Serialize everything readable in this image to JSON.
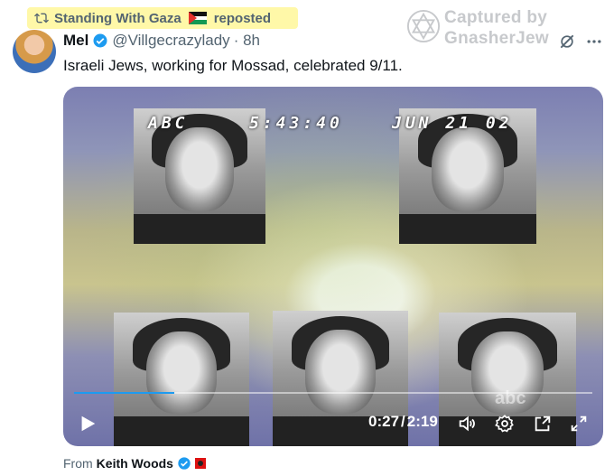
{
  "repost": {
    "reposter": "Standing With Gaza",
    "action": "reposted"
  },
  "watermark": {
    "line1": "Captured by",
    "line2": "GnasherJew"
  },
  "tweet": {
    "author_name": "Mel",
    "handle": "@Villgecrazylady",
    "time": "· 8h",
    "text": "Israeli Jews, working for Mossad, celebrated 9/11."
  },
  "video": {
    "overlay": {
      "network": "ABC",
      "clock": "5:43:40",
      "date": "JUN 21 02"
    },
    "bug": "abc",
    "current_time": "0:27",
    "separator": "/",
    "duration": "2:19",
    "progress_fraction": 0.194
  },
  "attribution": {
    "label": "From",
    "source": "Keith Woods"
  },
  "colors": {
    "accent": "#1d9bf0",
    "highlight": "#fff8a8",
    "muted_text": "#536471"
  },
  "icons": {
    "repost": "repost-icon",
    "verified": "verified-badge-icon",
    "grok": "grok-icon",
    "more": "more-icon",
    "play": "play-icon",
    "volume": "volume-icon",
    "settings": "gear-icon",
    "popout": "popout-icon",
    "fullscreen": "fullscreen-icon"
  }
}
